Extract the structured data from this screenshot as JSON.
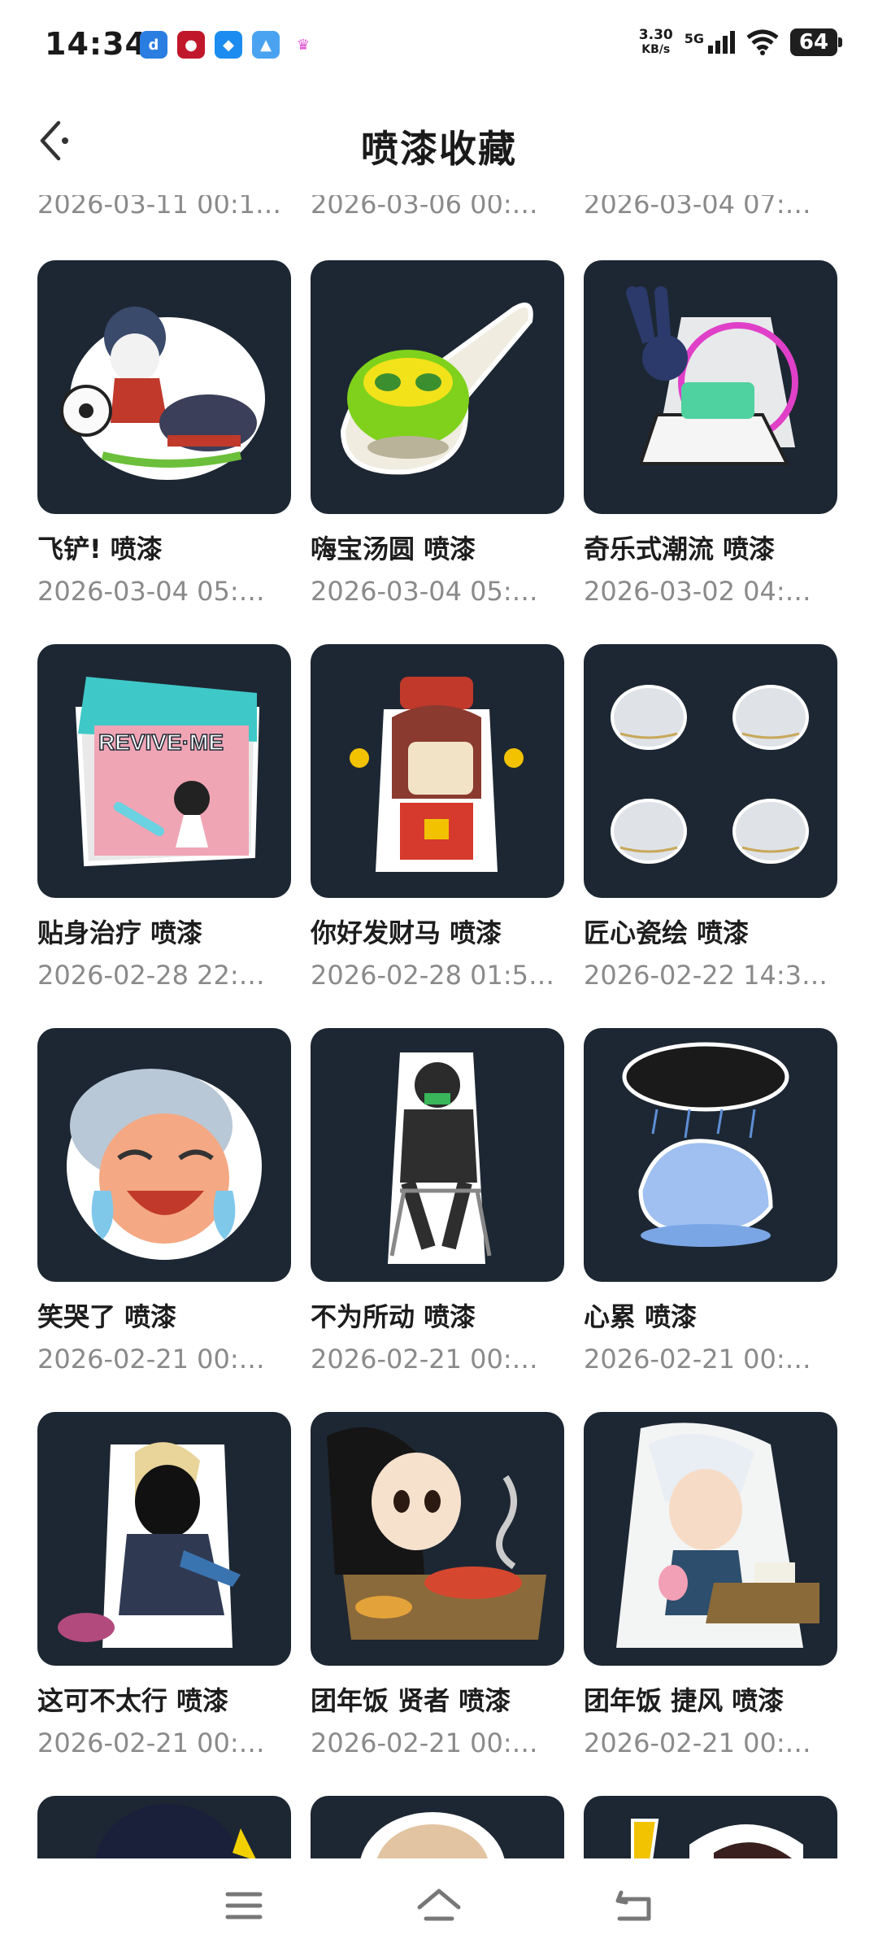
{
  "status_bar": {
    "time": "14:34",
    "net_speed_value": "3.30",
    "net_speed_unit": "KB/s",
    "network": "5G",
    "battery": "64"
  },
  "header": {
    "title": "喷漆收藏"
  },
  "partial_dates": [
    "2026-03-11 00:1…",
    "2026-03-06 00:…",
    "2026-03-04 07:…"
  ],
  "items": [
    {
      "name": "飞铲! 喷漆",
      "date": "2026-03-04 05:…"
    },
    {
      "name": "嗨宝汤圆 喷漆",
      "date": "2026-03-04 05:…"
    },
    {
      "name": "奇乐式潮流 喷漆",
      "date": "2026-03-02 04:…"
    },
    {
      "name": "贴身治疗 喷漆",
      "date": "2026-02-28 22:…",
      "image_text": "REVIVE·ME"
    },
    {
      "name": "你好发财马 喷漆",
      "date": "2026-02-28 01:5…"
    },
    {
      "name": "匠心瓷绘 喷漆",
      "date": "2026-02-22 14:3…"
    },
    {
      "name": "笑哭了 喷漆",
      "date": "2026-02-21 00:…"
    },
    {
      "name": "不为所动 喷漆",
      "date": "2026-02-21 00:…"
    },
    {
      "name": "心累 喷漆",
      "date": "2026-02-21 00:…"
    },
    {
      "name": "这可不太行 喷漆",
      "date": "2026-02-21 00:…"
    },
    {
      "name": "团年饭 贤者 喷漆",
      "date": "2026-02-21 00:…"
    },
    {
      "name": "团年饭 捷风 喷漆",
      "date": "2026-02-21 00:…"
    }
  ],
  "icons": {
    "back": "back-arrow-icon",
    "menu": "menu-icon",
    "home": "home-icon",
    "return": "return-icon"
  },
  "colors": {
    "tile_bg": "#1d2733",
    "date_text": "#8a8a8a"
  }
}
